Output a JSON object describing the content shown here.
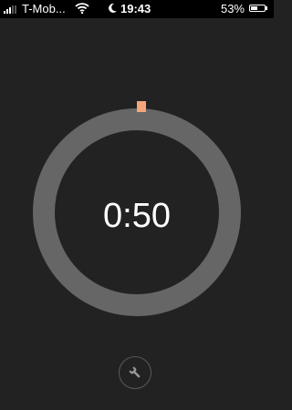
{
  "status_bar": {
    "carrier": "T-Mob...",
    "time": "19:43",
    "battery_percent": "53%",
    "battery_level": 0.53,
    "icons": [
      "signal-icon",
      "wifi-icon",
      "moon-icon",
      "battery-icon"
    ]
  },
  "timer": {
    "display": "0:50",
    "progress": 0.0,
    "ring_color": "#666666",
    "marker_color": "#f3a57b"
  },
  "controls": {
    "settings_icon": "wrench-icon"
  },
  "colors": {
    "background": "#222222",
    "status_bar": "#000000",
    "text": "#ffffff"
  }
}
